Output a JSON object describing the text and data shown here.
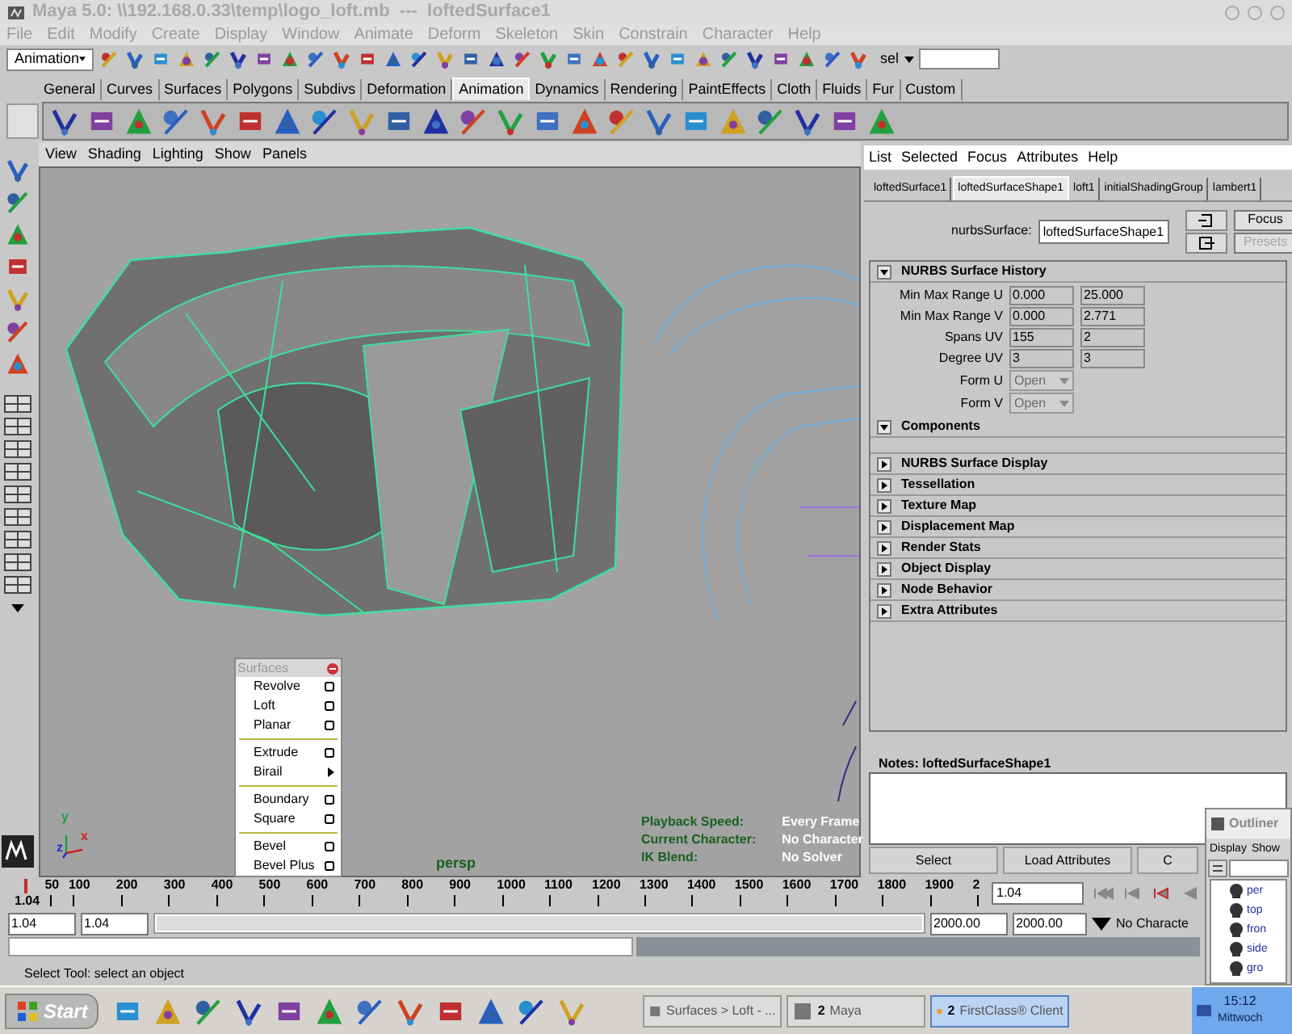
{
  "window": {
    "title": "Maya 5.0: \\\\192.168.0.33\\temp\\logo_loft.mb  ---  loftedSurface1"
  },
  "menu_bar": [
    "File",
    "Edit",
    "Modify",
    "Create",
    "Display",
    "Window",
    "Animate",
    "Deform",
    "Skeleton",
    "Skin",
    "Constrain",
    "Character",
    "Help"
  ],
  "status_line": {
    "menu_set": "Animation",
    "selection_label": "sel"
  },
  "shelf_tabs": [
    {
      "label": "General",
      "selected": false
    },
    {
      "label": "Curves",
      "selected": false
    },
    {
      "label": "Surfaces",
      "selected": false
    },
    {
      "label": "Polygons",
      "selected": false
    },
    {
      "label": "Subdivs",
      "selected": false
    },
    {
      "label": "Deformation",
      "selected": false
    },
    {
      "label": "Animation",
      "selected": true
    },
    {
      "label": "Dynamics",
      "selected": false
    },
    {
      "label": "Rendering",
      "selected": false
    },
    {
      "label": "PaintEffects",
      "selected": false
    },
    {
      "label": "Cloth",
      "selected": false
    },
    {
      "label": "Fluids",
      "selected": false
    },
    {
      "label": "Fur",
      "selected": false
    },
    {
      "label": "Custom",
      "selected": false
    }
  ],
  "viewport": {
    "menu": [
      "View",
      "Shading",
      "Lighting",
      "Show",
      "Panels"
    ],
    "camera": "persp",
    "axis_labels": [
      "y",
      "z",
      "x"
    ],
    "hud": [
      {
        "label": "Playback Speed:",
        "value": "Every Frame"
      },
      {
        "label": "Current Character:",
        "value": "No Character"
      },
      {
        "label": "IK Blend:",
        "value": "No Solver"
      }
    ]
  },
  "surfaces_menu": {
    "title": "Surfaces",
    "items": [
      {
        "kind": "option",
        "label": "Revolve"
      },
      {
        "kind": "option",
        "label": "Loft"
      },
      {
        "kind": "option",
        "label": "Planar"
      },
      {
        "kind": "separator"
      },
      {
        "kind": "option",
        "label": "Extrude"
      },
      {
        "kind": "submenu",
        "label": "Birail"
      },
      {
        "kind": "separator"
      },
      {
        "kind": "option",
        "label": "Boundary"
      },
      {
        "kind": "option",
        "label": "Square"
      },
      {
        "kind": "separator"
      },
      {
        "kind": "option",
        "label": "Bevel"
      },
      {
        "kind": "option",
        "label": "Bevel Plus"
      }
    ]
  },
  "attribute_editor": {
    "menu": [
      "List",
      "Selected",
      "Focus",
      "Attributes",
      "Help"
    ],
    "tabs": [
      {
        "label": "loftedSurface1",
        "selected": false
      },
      {
        "label": "loftedSurfaceShape1",
        "selected": true
      },
      {
        "label": "loft1",
        "selected": false
      },
      {
        "label": "initialShadingGroup",
        "selected": false
      },
      {
        "label": "lambert1",
        "selected": false
      }
    ],
    "node_label": "nurbsSurface:",
    "node_name": "loftedSurfaceShape1",
    "buttons": [
      {
        "label": "Focus",
        "disabled": false
      },
      {
        "label": "Presets",
        "disabled": true
      }
    ],
    "sections": [
      {
        "title": "NURBS Surface History",
        "expanded": true,
        "rows": [
          {
            "kind": "pair",
            "label": "Min Max Range U",
            "values": [
              "0.000",
              "25.000"
            ]
          },
          {
            "kind": "pair",
            "label": "Min Max Range V",
            "values": [
              "0.000",
              "2.771"
            ]
          },
          {
            "kind": "pair",
            "label": "Spans UV",
            "values": [
              "155",
              "2"
            ]
          },
          {
            "kind": "pair",
            "label": "Degree UV",
            "values": [
              "3",
              "3"
            ]
          },
          {
            "kind": "dropdown",
            "label": "Form U",
            "value": "Open",
            "disabled": true
          },
          {
            "kind": "dropdown",
            "label": "Form V",
            "value": "Open",
            "disabled": true
          }
        ]
      },
      {
        "title": "Components",
        "expanded": true
      },
      {
        "title": "NURBS Surface Display",
        "expanded": false
      },
      {
        "title": "Tessellation",
        "expanded": false
      },
      {
        "title": "Texture Map",
        "expanded": false
      },
      {
        "title": "Displacement Map",
        "expanded": false
      },
      {
        "title": "Render Stats",
        "expanded": false
      },
      {
        "title": "Object Display",
        "expanded": false
      },
      {
        "title": "Node Behavior",
        "expanded": false
      },
      {
        "title": "Extra Attributes",
        "expanded": false
      }
    ],
    "notes_title": "Notes: loftedSurfaceShape1",
    "bottom_buttons": [
      "Select",
      "Load Attributes",
      "C"
    ]
  },
  "time_slider": {
    "start_label": "1.04",
    "level": 0,
    "ticks": [
      "50",
      "100",
      "200",
      "300",
      "400",
      "500",
      "600",
      "700",
      "800",
      "900",
      "1000",
      "1100",
      "1200",
      "1300",
      "1400",
      "1500",
      "1600",
      "1700",
      "1800",
      "1900",
      "2"
    ],
    "current_time": "1.04"
  },
  "range_slider": {
    "level": 1,
    "start": "1.04",
    "playback_start": "1.04",
    "playback_end": "2000.00",
    "end": "2000.00",
    "character": "No Characte"
  },
  "help_line": "Select Tool: select an object",
  "outliner": {
    "title": "Outliner",
    "menu": [
      "Display",
      "Show"
    ],
    "items": [
      "per",
      "top",
      "fron",
      "side",
      "gro"
    ]
  },
  "taskbar": {
    "start": "Start",
    "tasks": [
      {
        "label": "Surfaces > Loft - ...",
        "selected": false
      },
      {
        "count": "2",
        "label": "Maya",
        "selected": false
      },
      {
        "count": "2",
        "label": "FirstClass® Client",
        "selected": true
      }
    ],
    "time": "15:12",
    "day": "Mittwoch"
  }
}
